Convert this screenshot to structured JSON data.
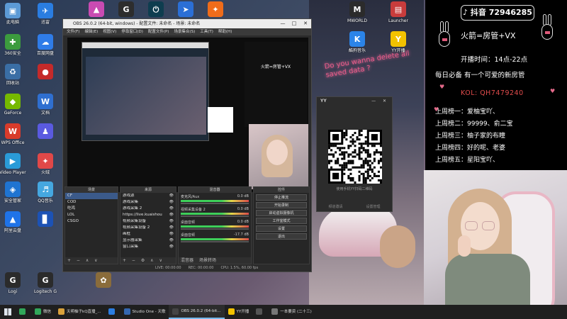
{
  "desktop_icons": [
    {
      "label": "此电脑",
      "color": "#5c9ad6",
      "glyph": "▣",
      "icon": "computer-icon"
    },
    {
      "label": "迅雷",
      "color": "#2a7de1",
      "glyph": "✈",
      "icon": "xunlei-icon"
    },
    {
      "label": "",
      "color": "#c94bb2",
      "glyph": "▲",
      "icon": "app-icon"
    },
    {
      "label": "",
      "color": "#2d2d2d",
      "glyph": "G",
      "icon": "steelseries-icon"
    },
    {
      "label": "",
      "color": "#0e3d4f",
      "glyph": "⏻",
      "icon": "power-app-icon"
    },
    {
      "label": "",
      "color": "#2b6fd6",
      "glyph": "➤",
      "icon": "arrow-app-icon"
    },
    {
      "label": "",
      "color": "#ef6c1a",
      "glyph": "✦",
      "icon": "orange-app-icon"
    },
    {
      "label": "360安全",
      "color": "#3c9b3e",
      "glyph": "✚",
      "icon": "security-icon"
    },
    {
      "label": "百度网盘",
      "color": "#2f7ce8",
      "glyph": "☁",
      "icon": "baidu-netdisk-icon"
    },
    {
      "label": "回收站",
      "color": "#3a6ea5",
      "glyph": "♻",
      "icon": "recycle-bin-icon"
    },
    {
      "label": "",
      "color": "#c42a2a",
      "glyph": "●",
      "icon": "record-icon"
    },
    {
      "label": "GeForce",
      "color": "#76b900",
      "glyph": "◆",
      "icon": "nvidia-icon"
    },
    {
      "label": "文档",
      "color": "#2f6fd0",
      "glyph": "W",
      "icon": "word-icon"
    },
    {
      "label": "WPS Office",
      "color": "#d83b2b",
      "glyph": "W",
      "icon": "wps-icon"
    },
    {
      "label": "",
      "color": "#5a5ae0",
      "glyph": "♟",
      "icon": "people-icon"
    },
    {
      "label": "Video Player",
      "color": "#2a9bd8",
      "glyph": "▶",
      "icon": "video-player-icon"
    },
    {
      "label": "火绒",
      "color": "#e04848",
      "glyph": "✦",
      "icon": "fire-icon"
    },
    {
      "label": "安全管家",
      "color": "#1f74d1",
      "glyph": "◈",
      "icon": "shield-icon"
    },
    {
      "label": "QQ音乐",
      "color": "#45a7e0",
      "glyph": "♬",
      "icon": "qq-music-icon"
    },
    {
      "label": "阿里云盘",
      "color": "#1f73e8",
      "glyph": "▲",
      "icon": "cloud-drive-icon"
    },
    {
      "label": "",
      "color": "#1c52b5",
      "glyph": "▊",
      "icon": "blue-doc-icon"
    },
    {
      "label": "Logi",
      "color": "#2b2b2b",
      "glyph": "G",
      "icon": "logitech-icon"
    },
    {
      "label": "Logitech G",
      "color": "#2b2b2b",
      "glyph": "G",
      "icon": "logitech-g-icon"
    },
    {
      "label": "",
      "color": "#8a6c3b",
      "glyph": "✿",
      "icon": "game-icon"
    }
  ],
  "top_right_icons": [
    {
      "label": "MWORLD",
      "color": "#2b2b2b",
      "glyph": "M",
      "icon": "mworld-icon"
    },
    {
      "label": "Launcher",
      "color": "#c83c3c",
      "glyph": "▤",
      "icon": "launcher-icon"
    },
    {
      "label": "酷狗音乐",
      "color": "#2b84e8",
      "glyph": "K",
      "icon": "kugou-icon"
    },
    {
      "label": "YY开播",
      "color": "#f3c200",
      "glyph": "Y",
      "icon": "yy-live-icon"
    }
  ],
  "obs": {
    "title": "OBS 26.0.2 (64-bit, windows) - 配置文件: 未命名 - 场景: 未命名",
    "menu": [
      "文件(F)",
      "编辑(E)",
      "视图(V)",
      "停靠窗口(D)",
      "配置文件(P)",
      "场景集合(S)",
      "工具(T)",
      "帮助(H)"
    ],
    "window_controls": [
      "—",
      "□",
      "✕"
    ],
    "panel_scenes": "场景",
    "panel_sources": "来源",
    "panel_mixer": "混音器",
    "panel_controls": "控件",
    "scenes": [
      "CF",
      "COD",
      "吃鸡",
      "LOL",
      "CSGO"
    ],
    "sources": [
      "游戏源",
      "游戏采集",
      "游戏采集 2",
      "https://live.kuaishou...",
      "视频采集设备",
      "视频采集设备 2",
      "画框",
      "显示器采集",
      "窗口采集"
    ],
    "mixer": [
      {
        "name": "麦克风/Aux",
        "db": "0.0 dB"
      },
      {
        "name": "视频采集设备 2",
        "db": "0.0 dB"
      },
      {
        "name": "桌面音频",
        "db": "0.0 dB"
      },
      {
        "name": "桌面音频",
        "db": "-17.7 dB"
      }
    ],
    "controls": [
      "停止推流",
      "开始录制",
      "启动虚拟摄像机",
      "工作室模式",
      "设置",
      "退出"
    ],
    "mixer_tabs": [
      "混音器",
      "场景转场"
    ],
    "status": [
      "LIVE: 00:00:00",
      "REC: 00:00:00",
      "CPU: 1.5%, 60.00 fps"
    ],
    "nested_info": "火箭=房管+VX"
  },
  "qr_window": {
    "title": "YY",
    "controls": "— ✕",
    "hint": "使用手机YY扫码二维码",
    "left": "频道邀请",
    "right": "设置管理"
  },
  "info_panel": {
    "douyin_label": "抖音 72946285",
    "headline": "火箭=房管+VX",
    "schedule": "开播时间：14点-22点",
    "slogan": "每日必备 有一个可爱的新房管",
    "kol": "KOL: QH7479240",
    "leaderboard": [
      "上周榜一：爱柚宝吖、",
      "上周榜二：99999、俞二宝",
      "上周榜三：柚子家的布瞳",
      "上周榜四：好的呢、老婆",
      "上周榜五：星阳宝吖、"
    ]
  },
  "stage": {
    "neon": "Do you wanna delete all saved data ?"
  },
  "taskbar": [
    {
      "label": "",
      "color": "#31a75a",
      "icon": "wechat-icon",
      "active": false
    },
    {
      "label": "微信",
      "color": "#31a75a",
      "icon": "chat-icon",
      "active": false
    },
    {
      "label": "天明柚子kQ直播_...",
      "color": "#d9a13b",
      "icon": "browser-icon",
      "active": false
    },
    {
      "label": "",
      "color": "#2b7de1",
      "icon": "explorer-icon",
      "active": false
    },
    {
      "label": "Studio One - 天歌",
      "color": "#3467b0",
      "icon": "studio-one-icon",
      "active": false
    },
    {
      "label": "OBS 26.0.2 (64-bit...",
      "color": "#444",
      "icon": "obs-icon",
      "active": true
    },
    {
      "label": "YY开播",
      "color": "#f3c200",
      "icon": "yy-icon",
      "active": false
    },
    {
      "label": "",
      "color": "#555",
      "icon": "file-icon",
      "active": false
    },
    {
      "label": "一本要资 (二十三)",
      "color": "#777",
      "icon": "music-icon",
      "active": false
    }
  ]
}
